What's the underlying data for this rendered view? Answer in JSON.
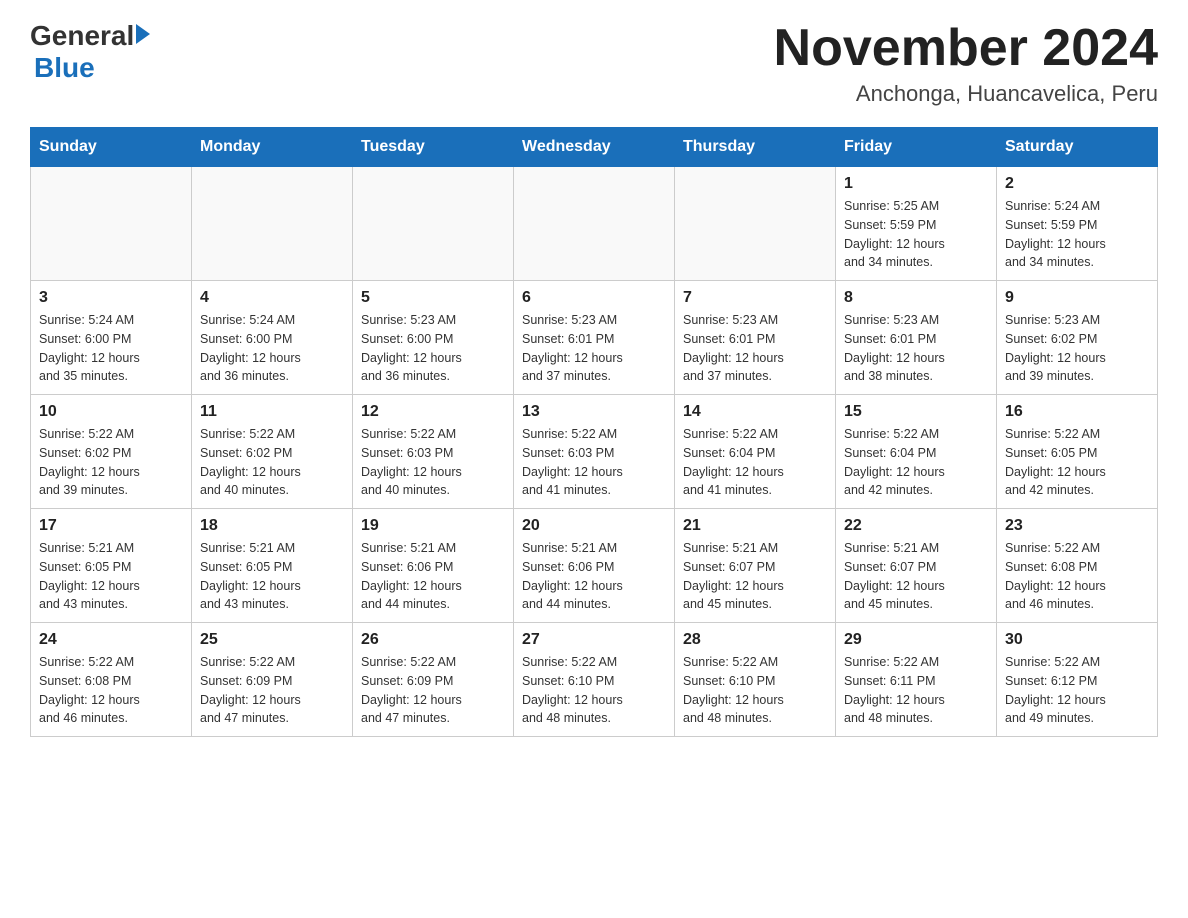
{
  "header": {
    "logo_general": "General",
    "logo_blue": "Blue",
    "month_year": "November 2024",
    "location": "Anchonga, Huancavelica, Peru"
  },
  "weekdays": [
    "Sunday",
    "Monday",
    "Tuesday",
    "Wednesday",
    "Thursday",
    "Friday",
    "Saturday"
  ],
  "weeks": [
    [
      {
        "day": "",
        "info": ""
      },
      {
        "day": "",
        "info": ""
      },
      {
        "day": "",
        "info": ""
      },
      {
        "day": "",
        "info": ""
      },
      {
        "day": "",
        "info": ""
      },
      {
        "day": "1",
        "info": "Sunrise: 5:25 AM\nSunset: 5:59 PM\nDaylight: 12 hours\nand 34 minutes."
      },
      {
        "day": "2",
        "info": "Sunrise: 5:24 AM\nSunset: 5:59 PM\nDaylight: 12 hours\nand 34 minutes."
      }
    ],
    [
      {
        "day": "3",
        "info": "Sunrise: 5:24 AM\nSunset: 6:00 PM\nDaylight: 12 hours\nand 35 minutes."
      },
      {
        "day": "4",
        "info": "Sunrise: 5:24 AM\nSunset: 6:00 PM\nDaylight: 12 hours\nand 36 minutes."
      },
      {
        "day": "5",
        "info": "Sunrise: 5:23 AM\nSunset: 6:00 PM\nDaylight: 12 hours\nand 36 minutes."
      },
      {
        "day": "6",
        "info": "Sunrise: 5:23 AM\nSunset: 6:01 PM\nDaylight: 12 hours\nand 37 minutes."
      },
      {
        "day": "7",
        "info": "Sunrise: 5:23 AM\nSunset: 6:01 PM\nDaylight: 12 hours\nand 37 minutes."
      },
      {
        "day": "8",
        "info": "Sunrise: 5:23 AM\nSunset: 6:01 PM\nDaylight: 12 hours\nand 38 minutes."
      },
      {
        "day": "9",
        "info": "Sunrise: 5:23 AM\nSunset: 6:02 PM\nDaylight: 12 hours\nand 39 minutes."
      }
    ],
    [
      {
        "day": "10",
        "info": "Sunrise: 5:22 AM\nSunset: 6:02 PM\nDaylight: 12 hours\nand 39 minutes."
      },
      {
        "day": "11",
        "info": "Sunrise: 5:22 AM\nSunset: 6:02 PM\nDaylight: 12 hours\nand 40 minutes."
      },
      {
        "day": "12",
        "info": "Sunrise: 5:22 AM\nSunset: 6:03 PM\nDaylight: 12 hours\nand 40 minutes."
      },
      {
        "day": "13",
        "info": "Sunrise: 5:22 AM\nSunset: 6:03 PM\nDaylight: 12 hours\nand 41 minutes."
      },
      {
        "day": "14",
        "info": "Sunrise: 5:22 AM\nSunset: 6:04 PM\nDaylight: 12 hours\nand 41 minutes."
      },
      {
        "day": "15",
        "info": "Sunrise: 5:22 AM\nSunset: 6:04 PM\nDaylight: 12 hours\nand 42 minutes."
      },
      {
        "day": "16",
        "info": "Sunrise: 5:22 AM\nSunset: 6:05 PM\nDaylight: 12 hours\nand 42 minutes."
      }
    ],
    [
      {
        "day": "17",
        "info": "Sunrise: 5:21 AM\nSunset: 6:05 PM\nDaylight: 12 hours\nand 43 minutes."
      },
      {
        "day": "18",
        "info": "Sunrise: 5:21 AM\nSunset: 6:05 PM\nDaylight: 12 hours\nand 43 minutes."
      },
      {
        "day": "19",
        "info": "Sunrise: 5:21 AM\nSunset: 6:06 PM\nDaylight: 12 hours\nand 44 minutes."
      },
      {
        "day": "20",
        "info": "Sunrise: 5:21 AM\nSunset: 6:06 PM\nDaylight: 12 hours\nand 44 minutes."
      },
      {
        "day": "21",
        "info": "Sunrise: 5:21 AM\nSunset: 6:07 PM\nDaylight: 12 hours\nand 45 minutes."
      },
      {
        "day": "22",
        "info": "Sunrise: 5:21 AM\nSunset: 6:07 PM\nDaylight: 12 hours\nand 45 minutes."
      },
      {
        "day": "23",
        "info": "Sunrise: 5:22 AM\nSunset: 6:08 PM\nDaylight: 12 hours\nand 46 minutes."
      }
    ],
    [
      {
        "day": "24",
        "info": "Sunrise: 5:22 AM\nSunset: 6:08 PM\nDaylight: 12 hours\nand 46 minutes."
      },
      {
        "day": "25",
        "info": "Sunrise: 5:22 AM\nSunset: 6:09 PM\nDaylight: 12 hours\nand 47 minutes."
      },
      {
        "day": "26",
        "info": "Sunrise: 5:22 AM\nSunset: 6:09 PM\nDaylight: 12 hours\nand 47 minutes."
      },
      {
        "day": "27",
        "info": "Sunrise: 5:22 AM\nSunset: 6:10 PM\nDaylight: 12 hours\nand 48 minutes."
      },
      {
        "day": "28",
        "info": "Sunrise: 5:22 AM\nSunset: 6:10 PM\nDaylight: 12 hours\nand 48 minutes."
      },
      {
        "day": "29",
        "info": "Sunrise: 5:22 AM\nSunset: 6:11 PM\nDaylight: 12 hours\nand 48 minutes."
      },
      {
        "day": "30",
        "info": "Sunrise: 5:22 AM\nSunset: 6:12 PM\nDaylight: 12 hours\nand 49 minutes."
      }
    ]
  ]
}
